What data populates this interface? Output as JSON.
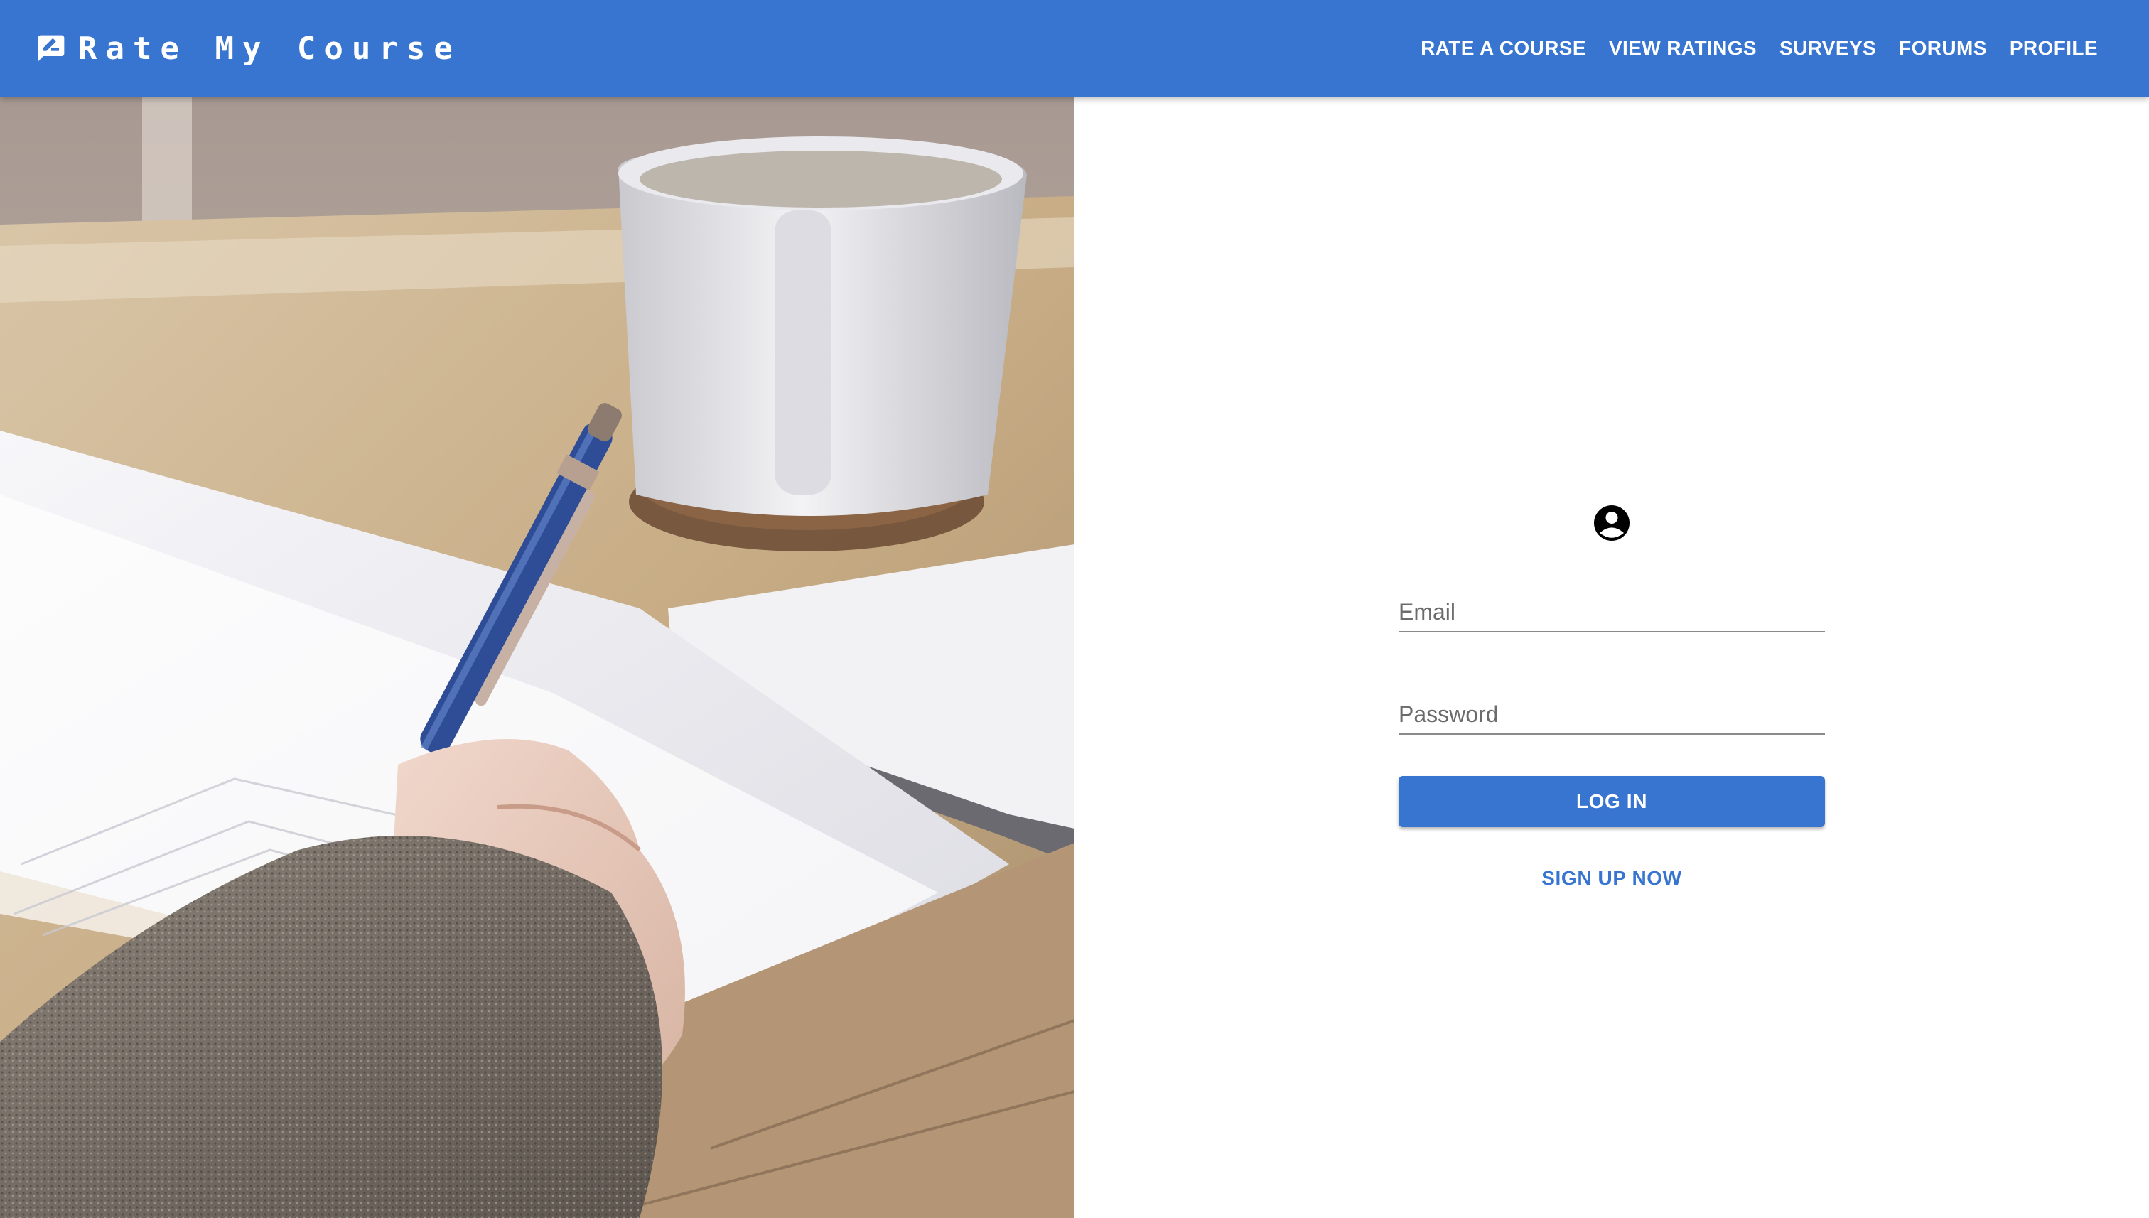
{
  "app": {
    "title": "Rate My Course",
    "brand_icon": "rate-review-icon"
  },
  "nav": {
    "items": [
      {
        "label": "RATE A COURSE"
      },
      {
        "label": "VIEW RATINGS"
      },
      {
        "label": "SURVEYS"
      },
      {
        "label": "FORUMS"
      },
      {
        "label": "PROFILE"
      }
    ]
  },
  "hero": {
    "image": "photo of a hand writing with a blue pen beside a coffee mug"
  },
  "login": {
    "icon": "account-circle-icon",
    "email_placeholder": "Email",
    "password_placeholder": "Password",
    "login_label": "LOG IN",
    "signup_label": "SIGN UP NOW"
  },
  "colors": {
    "primary": "#3875d0",
    "text_on_primary": "#ffffff"
  }
}
